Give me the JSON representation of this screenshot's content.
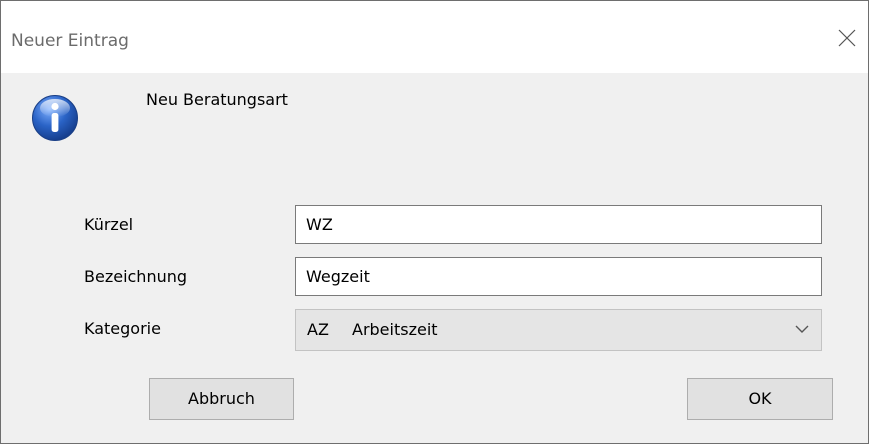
{
  "window": {
    "title": "Neuer Eintrag",
    "close_icon": "close-x-icon"
  },
  "dialog": {
    "icon": "info-icon",
    "message": "Neu Beratungsart"
  },
  "form": {
    "kuerzel": {
      "label": "Kürzel",
      "value": "WZ"
    },
    "bezeichnung": {
      "label": "Bezeichnung",
      "value": "Wegzeit"
    },
    "kategorie": {
      "label": "Kategorie",
      "selected_code": "AZ",
      "selected_text": "Arbeitszeit",
      "icon": "chevron-down-icon"
    }
  },
  "buttons": {
    "cancel_label": "Abbruch",
    "ok_label": "OK"
  },
  "colors": {
    "dialog_background": "#f0f0f0",
    "titlebar_background": "#ffffff",
    "icon_blue": "#1f56b8"
  }
}
